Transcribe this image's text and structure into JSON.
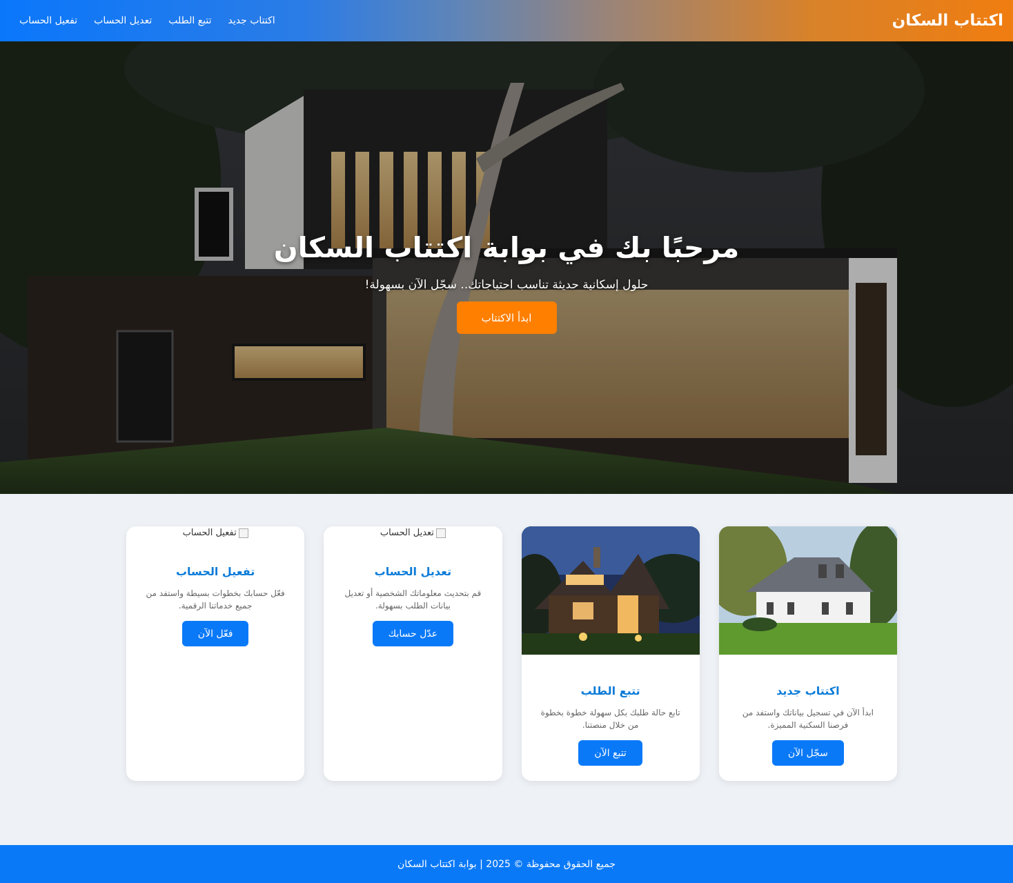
{
  "header": {
    "brand": "اكتتاب السكان",
    "nav": [
      "اكتتاب جديد",
      "تتبع الطلب",
      "تعديل الحساب",
      "تفعيل الحساب"
    ]
  },
  "hero": {
    "title": "مرحبًا بك في بوابة اكتتاب السكان",
    "subtitle": "حلول إسكانية حديثة تناسب احتياجاتك.. سجّل الآن بسهولة!",
    "button": "ابدأ الاكتتاب"
  },
  "cards": [
    {
      "title": "اكتتاب جديد",
      "desc": "ابدأ الآن في تسجيل بياناتك واستفد من فرصنا السكنية المميزة.",
      "button": "سجّل الآن"
    },
    {
      "title": "تتبع الطلب",
      "desc": "تابع حالة طلبك بكل سهولة خطوة بخطوة من خلال منصتنا.",
      "button": "تتبع الآن"
    },
    {
      "title": "تعديل الحساب",
      "image_alt": "تعديل الحساب",
      "desc": "قم بتحديث معلوماتك الشخصية أو تعديل بيانات الطلب بسهولة.",
      "button": "عدّل حسابك"
    },
    {
      "title": "تفعيل الحساب",
      "image_alt": "تفعيل الحساب",
      "desc": "فعّل حسابك بخطوات بسيطة واستفد من جميع خدماتنا الرقمية.",
      "button": "فعّل الآن"
    }
  ],
  "footer": {
    "text": "جميع الحقوق محفوظة © 2025 | بوابة اكتتاب السكان"
  },
  "colors": {
    "accent_orange": "#ff7f00",
    "primary_blue": "#0a79f7",
    "card_title_blue": "#0a7bd8",
    "page_bg": "#eef1f5"
  }
}
